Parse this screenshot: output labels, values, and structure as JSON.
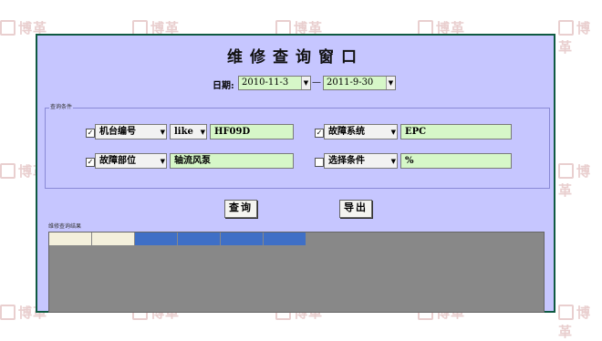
{
  "watermark": {
    "text": "博革"
  },
  "window": {
    "title": "维修查询窗口"
  },
  "date": {
    "label": "日期:",
    "from": "2010-11-3",
    "to": "2011-9-30",
    "separator": "—"
  },
  "criteria": {
    "group_label": "查询条件",
    "row1": {
      "field_select": "机台编号",
      "operator_select": "like",
      "value": "HF09D",
      "field2_select": "故障系统",
      "value2": "EPC"
    },
    "row2": {
      "field_select": "故障部位",
      "value": "轴流风泵",
      "field2_select": "选择条件",
      "value2": "%"
    }
  },
  "buttons": {
    "query": "查询",
    "export": "导出"
  },
  "results": {
    "label": "维修查询结果"
  },
  "colors": {
    "window_bg": "#c6c6ff",
    "field_bg": "#d6f7c8",
    "header_blue": "#3f6fc6",
    "header_cream": "#f4f0dc",
    "grid_bg": "#888888"
  }
}
